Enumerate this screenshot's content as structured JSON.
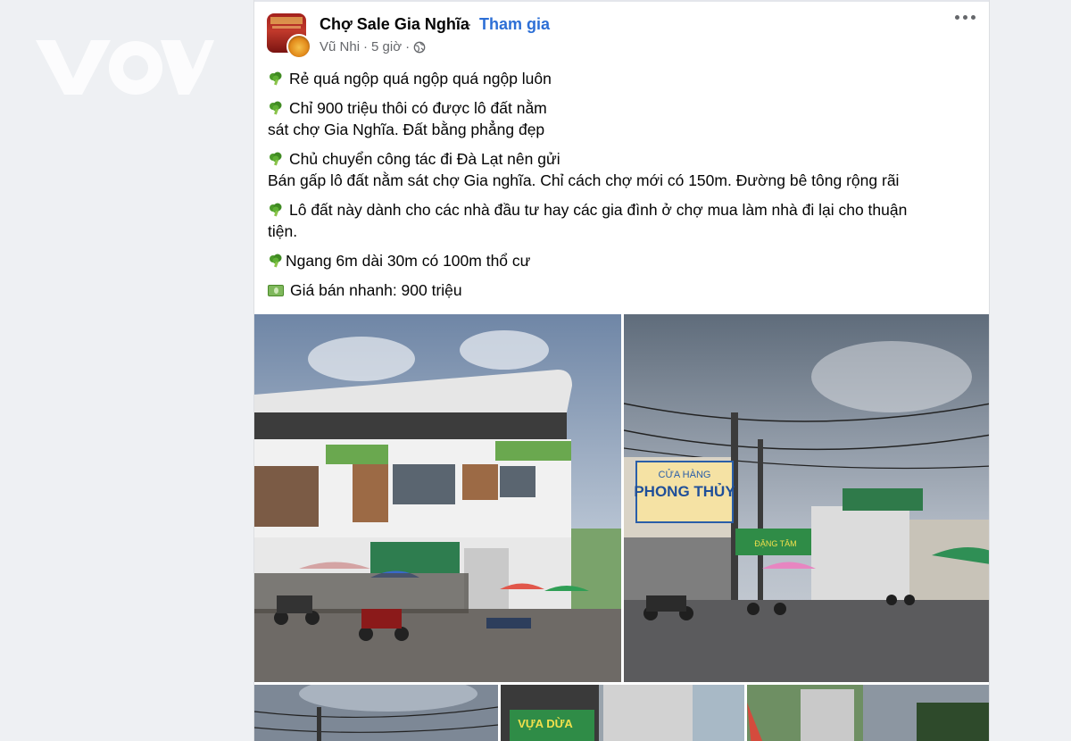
{
  "watermark": {
    "text": "VOV"
  },
  "post": {
    "group_name": "Chợ Sale Gia Nghĩa",
    "separator": "·",
    "join_label": "Tham gia",
    "author": "Vũ Nhi",
    "meta_separator": "·",
    "time": "5 giờ",
    "privacy_icon": "globe-icon",
    "more_icon": "more-options-icon",
    "paragraphs": [
      {
        "icon": "broccoli-icon",
        "lines": [
          "Rẻ quá ngộp quá ngộp quá ngộp luôn"
        ]
      },
      {
        "icon": "broccoli-icon",
        "lines": [
          "Chỉ 900 triệu thôi có được lô đất nằm",
          "sát chợ Gia Nghĩa. Đất bằng phẳng đẹp"
        ]
      },
      {
        "icon": "broccoli-icon",
        "lines": [
          "Chủ chuyển công tác đi Đà Lạt nên gửi",
          "Bán gấp lô đất nằm sát chợ Gia nghĩa. Chỉ cách chợ mới có 150m. Đường bê tông rộng rãi"
        ]
      },
      {
        "icon": "broccoli-icon",
        "lines": [
          "Lô đất này dành cho các nhà đầu tư hay các gia đình ở chợ mua làm nhà đi lại cho thuận",
          "tiện."
        ]
      },
      {
        "icon": "broccoli-icon",
        "lines": [
          "Ngang 6m dài 30m có 100m thổ cư"
        ]
      },
      {
        "icon": "money-icon",
        "lines": [
          "Giá bán nhanh: 900 triệu"
        ]
      }
    ],
    "photos": {
      "photo2_sign_line1": "CỬA HÀNG",
      "photo2_sign_line2": "PHONG THỦY",
      "photo2_sign2": "ĐẶNG TÂM",
      "photo4_sign": "VỰA DỪA"
    }
  },
  "colors": {
    "join_link": "#2d6fd6",
    "background": "#eef0f3",
    "card": "#ffffff",
    "secondary_text": "#65676b"
  }
}
